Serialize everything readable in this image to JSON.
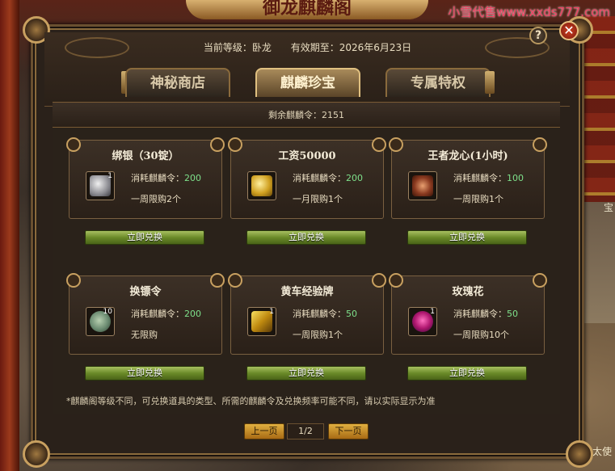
{
  "watermark": "小雪代售www.xxds777.com",
  "banner_title": "御龙麒麟阁",
  "header": {
    "level_label": "当前等级：卧龙",
    "expiry_label": "有效期至：2026年6月23日"
  },
  "help_label": "?",
  "close_label": "✕",
  "tabs": [
    {
      "label": "神秘商店",
      "active": false
    },
    {
      "label": "麒麟珍宝",
      "active": true
    },
    {
      "label": "专属特权",
      "active": false
    }
  ],
  "remaining": "剩余麒麟令：2151",
  "items": [
    {
      "title": "绑银（30锭）",
      "icon": "silver-ingot-icon",
      "qty": "1",
      "cost_label": "消耗麒麟令：",
      "cost": "200",
      "limit": "一周限购2个",
      "button": "立即兑换"
    },
    {
      "title": "工资50000",
      "icon": "gold-coins-icon",
      "qty": "",
      "cost_label": "消耗麒麟令：",
      "cost": "200",
      "limit": "一月限购1个",
      "button": "立即兑换"
    },
    {
      "title": "王者龙心(1小时)",
      "icon": "dragon-heart-icon",
      "qty": "",
      "cost_label": "消耗麒麟令：",
      "cost": "100",
      "limit": "一周限购1个",
      "button": "立即兑换"
    },
    {
      "title": "换镖令",
      "icon": "escort-token-icon",
      "qty": "10",
      "cost_label": "消耗麒麟令：",
      "cost": "200",
      "limit": "无限购",
      "button": "立即兑换"
    },
    {
      "title": "黄车经验牌",
      "icon": "yellow-cart-exp-icon",
      "qty": "1",
      "cost_label": "消耗麒麟令：",
      "cost": "50",
      "limit": "一周限购1个",
      "button": "立即兑换"
    },
    {
      "title": "玫瑰花",
      "icon": "rose-icon",
      "qty": "1",
      "cost_label": "消耗麒麟令：",
      "cost": "50",
      "limit": "一周限购10个",
      "button": "立即兑换"
    }
  ],
  "note": "*麒麟阁等级不同，可兑换道具的类型、所需的麒麟令及兑换频率可能不同，请以实际显示为准",
  "pager": {
    "prev": "上一页",
    "page": "1/2",
    "next": "下一页"
  },
  "bg_text_right": "宝",
  "bg_text_bottom": "赏太使",
  "colors": {
    "accent_gold": "#c8a060",
    "cost_green": "#7ee08a",
    "button_green": "#6a8a28",
    "pager_orange": "#e0b040"
  }
}
